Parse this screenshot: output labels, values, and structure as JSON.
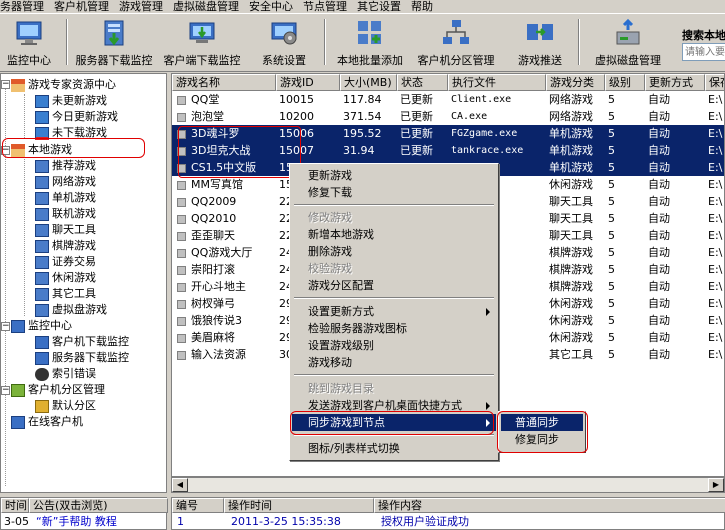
{
  "menubar": [
    "务器管理",
    "客户机管理",
    "游戏管理",
    "虚拟磁盘管理",
    "安全中心",
    "节点管理",
    "其它设置",
    "帮助"
  ],
  "toolbar": {
    "buttons": [
      "监控中心",
      "服务器下载监控",
      "客户端下载监控",
      "系统设置",
      "本地批量添加",
      "客户机分区管理",
      "游戏推送",
      "虚拟磁盘管理"
    ],
    "search_label": "搜索本地",
    "search_placeholder": "请输入要"
  },
  "tree": {
    "resource_center": "游戏专家资源中心",
    "resource_children": [
      "未更新游戏",
      "今日更新游戏",
      "未下载游戏"
    ],
    "local_games": "本地游戏",
    "local_children": [
      "推荐游戏",
      "网络游戏",
      "单机游戏",
      "联机游戏",
      "聊天工具",
      "棋牌游戏",
      "证券交易",
      "休闲游戏",
      "其它工具",
      "虚拟盘游戏"
    ],
    "monitor_center": "监控中心",
    "monitor_children": [
      "客户机下载监控",
      "服务器下载监控",
      "索引错误"
    ],
    "partition_mgmt": "客户机分区管理",
    "partition_children": [
      "默认分区"
    ],
    "online_clients": "在线客户机"
  },
  "grid": {
    "headers": [
      "游戏名称",
      "游戏ID",
      "大小(MB)",
      "状态",
      "执行文件",
      "游戏分类",
      "级别",
      "更新方式",
      "保存"
    ],
    "rows": [
      {
        "name": "QQ堂",
        "id": "10015",
        "size": "117.84",
        "status": "已更新",
        "exe": "Client.exe",
        "category": "网络游戏",
        "level": "5",
        "mode": "自动",
        "save": "E:\\",
        "selected": false
      },
      {
        "name": "泡泡堂",
        "id": "10200",
        "size": "371.54",
        "status": "已更新",
        "exe": "CA.exe",
        "category": "网络游戏",
        "level": "5",
        "mode": "自动",
        "save": "E:\\",
        "selected": false
      },
      {
        "name": "3D魂斗罗",
        "id": "15006",
        "size": "195.52",
        "status": "已更新",
        "exe": "FGZgame.exe",
        "category": "单机游戏",
        "level": "5",
        "mode": "自动",
        "save": "E:\\",
        "selected": true
      },
      {
        "name": "3D坦克大战",
        "id": "15007",
        "size": "31.94",
        "status": "已更新",
        "exe": "tankrace.exe",
        "category": "单机游戏",
        "level": "5",
        "mode": "自动",
        "save": "E:\\",
        "selected": true
      },
      {
        "name": "CS1.5中文版",
        "id": "15",
        "size": "",
        "status": "",
        "exe": "exe",
        "category": "单机游戏",
        "level": "5",
        "mode": "自动",
        "save": "E:\\",
        "selected": true
      },
      {
        "name": "MM写真馆",
        "id": "15",
        "size": "",
        "status": "",
        "exe": "",
        "category": "休闲游戏",
        "level": "5",
        "mode": "自动",
        "save": "E:\\",
        "selected": false
      },
      {
        "name": "QQ2009",
        "id": "22",
        "size": "",
        "status": "",
        "exe": "exe",
        "category": "聊天工具",
        "level": "5",
        "mode": "自动",
        "save": "E:\\",
        "selected": false
      },
      {
        "name": "QQ2010",
        "id": "22",
        "size": "",
        "status": "",
        "exe": "exe",
        "category": "聊天工具",
        "level": "5",
        "mode": "自动",
        "save": "E:\\",
        "selected": false
      },
      {
        "name": "歪歪聊天",
        "id": "22",
        "size": "",
        "status": "",
        "exe": "",
        "category": "聊天工具",
        "level": "5",
        "mode": "自动",
        "save": "E:\\",
        "selected": false
      },
      {
        "name": "QQ游戏大厅",
        "id": "24",
        "size": "",
        "status": "",
        "exe": "exe",
        "category": "棋牌游戏",
        "level": "5",
        "mode": "自动",
        "save": "E:\\",
        "selected": false
      },
      {
        "name": "崇阳打滚",
        "id": "24",
        "size": "",
        "status": "",
        "exe": "l.exe",
        "category": "棋牌游戏",
        "level": "5",
        "mode": "自动",
        "save": "E:\\",
        "selected": false
      },
      {
        "name": "开心斗地主",
        "id": "24",
        "size": "",
        "status": "",
        "exe": ".exe",
        "category": "棋牌游戏",
        "level": "5",
        "mode": "自动",
        "save": "E:\\",
        "selected": false
      },
      {
        "name": "树杈弹弓",
        "id": "29",
        "size": "",
        "status": "",
        "exe": "exe",
        "category": "休闲游戏",
        "level": "5",
        "mode": "自动",
        "save": "E:\\",
        "selected": false
      },
      {
        "name": "饿狼传说3",
        "id": "29",
        "size": "",
        "status": "",
        "exe": "",
        "category": "休闲游戏",
        "level": "5",
        "mode": "自动",
        "save": "E:\\",
        "selected": false
      },
      {
        "name": "美眉麻将",
        "id": "29",
        "size": "",
        "status": "",
        "exe": "xe",
        "category": "休闲游戏",
        "level": "5",
        "mode": "自动",
        "save": "E:\\",
        "selected": false
      },
      {
        "name": "输入法资源",
        "id": "30",
        "size": "",
        "status": "",
        "exe": "xe",
        "category": "其它工具",
        "level": "5",
        "mode": "自动",
        "save": "E:\\",
        "selected": false
      }
    ]
  },
  "context_menu": {
    "items": [
      {
        "label": "更新游戏",
        "disabled": false,
        "submenu": false,
        "highlight": false
      },
      {
        "label": "修复下载",
        "disabled": false,
        "submenu": false,
        "highlight": false
      },
      {
        "label": "修改游戏",
        "disabled": true,
        "submenu": false,
        "highlight": false
      },
      {
        "label": "新增本地游戏",
        "disabled": false,
        "submenu": false,
        "highlight": false
      },
      {
        "label": "删除游戏",
        "disabled": false,
        "submenu": false,
        "highlight": false
      },
      {
        "label": "校验游戏",
        "disabled": true,
        "submenu": false,
        "highlight": false
      },
      {
        "label": "游戏分区配置",
        "disabled": false,
        "submenu": false,
        "highlight": false
      },
      {
        "label": "设置更新方式",
        "disabled": false,
        "submenu": true,
        "highlight": false
      },
      {
        "label": "检验服务器游戏图标",
        "disabled": false,
        "submenu": false,
        "highlight": false
      },
      {
        "label": "设置游戏级别",
        "disabled": false,
        "submenu": false,
        "highlight": false
      },
      {
        "label": "游戏移动",
        "disabled": false,
        "submenu": false,
        "highlight": false
      },
      {
        "label": "跳到游戏目录",
        "disabled": true,
        "submenu": false,
        "highlight": false
      },
      {
        "label": "发送游戏到客户机桌面快捷方式",
        "disabled": false,
        "submenu": true,
        "highlight": false
      },
      {
        "label": "同步游戏到节点",
        "disabled": false,
        "submenu": true,
        "highlight": true
      },
      {
        "label": "图标/列表样式切换",
        "disabled": false,
        "submenu": false,
        "highlight": false
      }
    ],
    "submenu": [
      "普通同步",
      "修复同步"
    ]
  },
  "bottom_left": {
    "headers": [
      "时间",
      "公告(双击浏览)"
    ],
    "row": [
      "3-05",
      "“新”手帮助 教程"
    ]
  },
  "bottom_right": {
    "headers": [
      "编号",
      "操作时间",
      "操作内容"
    ],
    "row": [
      "1",
      "2011-3-25 15:35:38",
      "授权用户验证成功"
    ]
  },
  "colors": {
    "selection": "#0a246a",
    "annotation": "#e00000",
    "window": "#d4d0c8"
  }
}
